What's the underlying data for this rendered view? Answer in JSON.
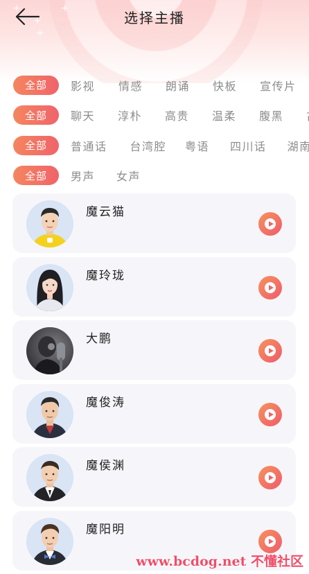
{
  "header": {
    "title": "选择主播",
    "back_icon": "arrow-left-icon"
  },
  "filters": [
    {
      "all_label": "全部",
      "tags": [
        "影视",
        "情感",
        "朗诵",
        "快板",
        "宣传片"
      ]
    },
    {
      "all_label": "全部",
      "tags": [
        "聊天",
        "淳朴",
        "高贵",
        "温柔",
        "腹黑",
        "古"
      ]
    },
    {
      "all_label": "全部",
      "tags": [
        "普通话",
        "台湾腔",
        "粤语",
        "四川话",
        "湖南话"
      ]
    },
    {
      "all_label": "全部",
      "tags": [
        "男声",
        "女声"
      ]
    }
  ],
  "anchors": [
    {
      "name": "魔云猫",
      "avatar": "cartoon-man-yellow-shirt"
    },
    {
      "name": "魔玲珑",
      "avatar": "cartoon-woman-long-hair"
    },
    {
      "name": "大鹏",
      "avatar": "photo-man-microphone"
    },
    {
      "name": "魔俊涛",
      "avatar": "cartoon-man-dark-jacket"
    },
    {
      "name": "魔侯渊",
      "avatar": "cartoon-man-suit"
    },
    {
      "name": "魔阳明",
      "avatar": "cartoon-man-bowtie"
    }
  ],
  "colors": {
    "accent_start": "#f5865f",
    "accent_end": "#f0636b",
    "card_bg": "#f6f6fa",
    "tag_text": "#8c8c8c"
  },
  "watermark": "www.bcdog.net 不懂社区"
}
